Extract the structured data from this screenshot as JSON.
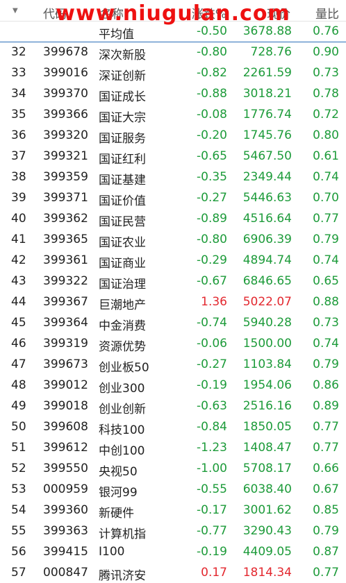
{
  "header": {
    "code_label": "代码",
    "name_label": "名称",
    "change_label": "涨跌%",
    "price_label": "现价",
    "ratio_label": "量比",
    "watermark": "www.niugulan.com"
  },
  "average_row": {
    "name": "平均值",
    "change": "-0.50",
    "price": "3678.88",
    "ratio": "0.76"
  },
  "rows": [
    {
      "idx": "32",
      "code": "399678",
      "name": "深次新股",
      "change": "-0.80",
      "price": "728.76",
      "ratio": "0.90",
      "dir": "down"
    },
    {
      "idx": "33",
      "code": "399016",
      "name": "深证创新",
      "change": "-0.82",
      "price": "2261.59",
      "ratio": "0.73",
      "dir": "down"
    },
    {
      "idx": "34",
      "code": "399370",
      "name": "国证成长",
      "change": "-0.88",
      "price": "3018.21",
      "ratio": "0.78",
      "dir": "down"
    },
    {
      "idx": "35",
      "code": "399366",
      "name": "国证大宗",
      "change": "-0.08",
      "price": "1776.74",
      "ratio": "0.72",
      "dir": "down"
    },
    {
      "idx": "36",
      "code": "399320",
      "name": "国证服务",
      "change": "-0.20",
      "price": "1745.76",
      "ratio": "0.80",
      "dir": "down"
    },
    {
      "idx": "37",
      "code": "399321",
      "name": "国证红利",
      "change": "-0.65",
      "price": "5467.50",
      "ratio": "0.61",
      "dir": "down"
    },
    {
      "idx": "38",
      "code": "399359",
      "name": "国证基建",
      "change": "-0.35",
      "price": "2349.44",
      "ratio": "0.74",
      "dir": "down"
    },
    {
      "idx": "39",
      "code": "399371",
      "name": "国证价值",
      "change": "-0.27",
      "price": "5446.63",
      "ratio": "0.70",
      "dir": "down"
    },
    {
      "idx": "40",
      "code": "399362",
      "name": "国证民营",
      "change": "-0.89",
      "price": "4516.64",
      "ratio": "0.77",
      "dir": "down"
    },
    {
      "idx": "41",
      "code": "399365",
      "name": "国证农业",
      "change": "-0.80",
      "price": "6906.39",
      "ratio": "0.79",
      "dir": "down"
    },
    {
      "idx": "42",
      "code": "399361",
      "name": "国证商业",
      "change": "-0.29",
      "price": "4894.74",
      "ratio": "0.74",
      "dir": "down"
    },
    {
      "idx": "43",
      "code": "399322",
      "name": "国证治理",
      "change": "-0.67",
      "price": "6846.65",
      "ratio": "0.65",
      "dir": "down"
    },
    {
      "idx": "44",
      "code": "399367",
      "name": "巨潮地产",
      "change": "1.36",
      "price": "5022.07",
      "ratio": "0.88",
      "dir": "up"
    },
    {
      "idx": "45",
      "code": "399364",
      "name": "中金消费",
      "change": "-0.74",
      "price": "5940.28",
      "ratio": "0.73",
      "dir": "down"
    },
    {
      "idx": "46",
      "code": "399319",
      "name": "资源优势",
      "change": "-0.06",
      "price": "1500.00",
      "ratio": "0.74",
      "dir": "down"
    },
    {
      "idx": "47",
      "code": "399673",
      "name": "创业板50",
      "change": "-0.27",
      "price": "1103.84",
      "ratio": "0.79",
      "dir": "down"
    },
    {
      "idx": "48",
      "code": "399012",
      "name": "创业300",
      "change": "-0.19",
      "price": "1954.06",
      "ratio": "0.86",
      "dir": "down"
    },
    {
      "idx": "49",
      "code": "399018",
      "name": "创业创新",
      "change": "-0.63",
      "price": "2516.16",
      "ratio": "0.89",
      "dir": "down"
    },
    {
      "idx": "50",
      "code": "399608",
      "name": "科技100",
      "change": "-0.84",
      "price": "1850.05",
      "ratio": "0.77",
      "dir": "down"
    },
    {
      "idx": "51",
      "code": "399612",
      "name": "中创100",
      "change": "-1.23",
      "price": "1408.47",
      "ratio": "0.77",
      "dir": "down"
    },
    {
      "idx": "52",
      "code": "399550",
      "name": "央视50",
      "change": "-1.00",
      "price": "5708.17",
      "ratio": "0.66",
      "dir": "down"
    },
    {
      "idx": "53",
      "code": "000959",
      "name": "银河99",
      "change": "-0.55",
      "price": "6038.40",
      "ratio": "0.67",
      "dir": "down"
    },
    {
      "idx": "54",
      "code": "399360",
      "name": "新硬件",
      "change": "-0.17",
      "price": "3001.62",
      "ratio": "0.85",
      "dir": "down"
    },
    {
      "idx": "55",
      "code": "399363",
      "name": "计算机指",
      "change": "-0.77",
      "price": "3290.43",
      "ratio": "0.79",
      "dir": "down"
    },
    {
      "idx": "56",
      "code": "399415",
      "name": "I100",
      "change": "-0.19",
      "price": "4409.05",
      "ratio": "0.87",
      "dir": "down"
    },
    {
      "idx": "57",
      "code": "000847",
      "name": "腾讯济安",
      "change": "0.17",
      "price": "1814.34",
      "ratio": "0.77",
      "dir": "up"
    }
  ],
  "colors": {
    "down": "#1d9b3a",
    "up": "#e3282f",
    "selection_line": "#2a6fb8",
    "watermark": "#ee1111"
  }
}
